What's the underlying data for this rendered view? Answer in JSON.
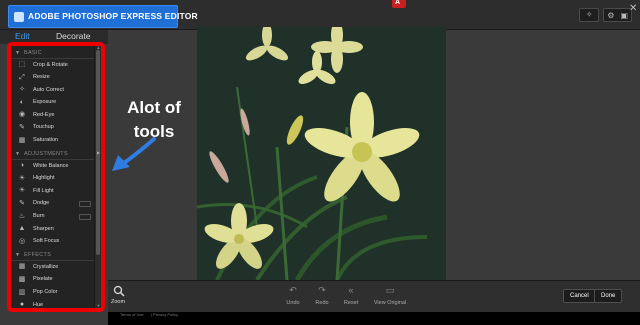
{
  "window": {
    "title": "ADOBE PHOTOSHOP EXPRESS EDITOR",
    "adobe_mark": "A"
  },
  "topbar_tools": {
    "wand": "✧",
    "gear": "⚙",
    "fit": "▣",
    "close": "✕"
  },
  "tabs": [
    {
      "label": "Edit",
      "active": true
    },
    {
      "label": "Decorate",
      "active": false
    }
  ],
  "sections": [
    {
      "label": "BASIC",
      "tools": [
        {
          "label": "Crop & Rotate",
          "icon": "⬚"
        },
        {
          "label": "Resize",
          "icon": "⤢"
        },
        {
          "label": "Auto Correct",
          "icon": "✧"
        },
        {
          "label": "Exposure",
          "icon": "◐"
        },
        {
          "label": "Red-Eye",
          "icon": "◉"
        },
        {
          "label": "Touchup",
          "icon": "✎"
        },
        {
          "label": "Saturation",
          "icon": "▦"
        }
      ]
    },
    {
      "label": "ADJUSTMENTS",
      "tools": [
        {
          "label": "White Balance",
          "icon": "◑"
        },
        {
          "label": "Highlight",
          "icon": "☀"
        },
        {
          "label": "Fill Light",
          "icon": "☀"
        },
        {
          "label": "Dodge",
          "icon": "✎",
          "has_sub": true
        },
        {
          "label": "Burn",
          "icon": "♨",
          "has_sub": true
        },
        {
          "label": "Sharpen",
          "icon": "▲"
        },
        {
          "label": "Soft Focus",
          "icon": "◎"
        }
      ]
    },
    {
      "label": "EFFECTS",
      "tools": [
        {
          "label": "Crystallize",
          "icon": "▦"
        },
        {
          "label": "Pixelate",
          "icon": "▩"
        },
        {
          "label": "Pop Color",
          "icon": "▥"
        },
        {
          "label": "Hue",
          "icon": "●"
        }
      ]
    }
  ],
  "annotation": {
    "text": "Alot of tools",
    "color": "#ffffff",
    "arrow_color": "#2f7de1",
    "box_color": "#e00000"
  },
  "bottom": {
    "zoom_label": "Zoom",
    "undo_label": "Undo",
    "redo_label": "Redo",
    "reset_label": "Reset",
    "view_original_label": "View Original",
    "cancel_label": "Cancel",
    "done_label": "Done"
  },
  "footer": {
    "terms": "Terms of Use",
    "privacy": "| Privacy Policy"
  },
  "colors": {
    "title_bar": "#1f6fd6",
    "edit_tab": "#3c9cf0"
  }
}
